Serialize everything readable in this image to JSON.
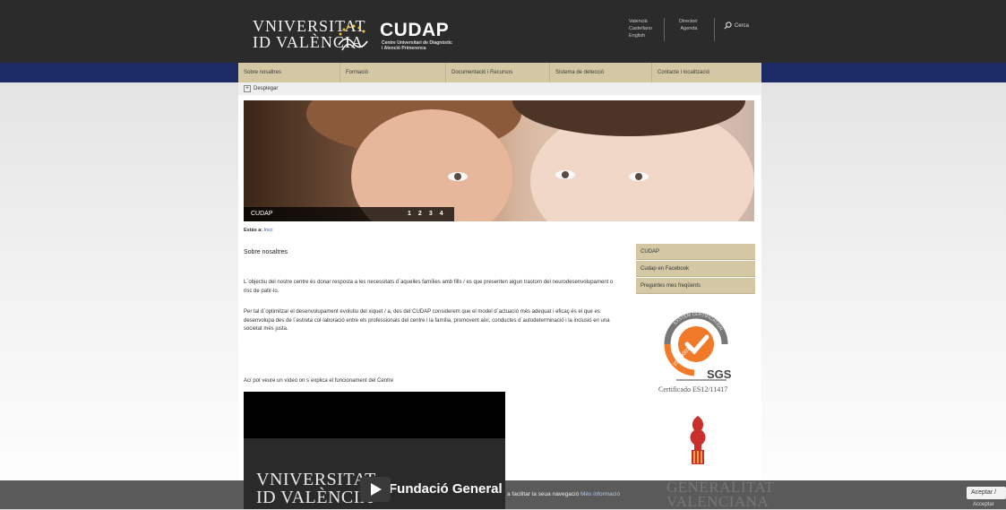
{
  "header": {
    "uv_line1": "VNIVERSITAT",
    "uv_line2": "ID VALÈNCIA",
    "cudap": "CUDAP",
    "cudap_sub1": "Centre Universitari de Diagnòstic",
    "cudap_sub2": "i Atenció Primerenca",
    "languages": [
      "Valencià",
      "Castellano",
      "English"
    ],
    "links": [
      "Directori",
      "Agenda"
    ],
    "search": "Cerca"
  },
  "menu": [
    "Sobre nosaltres",
    "Formació",
    "Documentació i Recursos",
    "Sistema de detecció",
    "Contacte i localització"
  ],
  "submenu": {
    "toggle": "Desplegar"
  },
  "hero": {
    "caption": "CUDAP",
    "slides": [
      "1",
      "2",
      "3",
      "4"
    ]
  },
  "breadcrumb": {
    "prefix": "Estàs a:",
    "link": "Inici"
  },
  "content": {
    "title": "Sobre nosaltres",
    "p1": "L´objectiu del nostre centre és donar resposta a les necessitats d´aquelles famílies amb fills / es que presenten algun trastorn del neurodesenvolupament o risc de patir-lo.",
    "p2": "Per tal d´optimitzar el desenvolupament evolutiu del xiquet / a, des del CUDAP considerem que el model d´actuació més adequat i eficaç és el que es desenvolupa des de l´estreta col·laboració entre els professionals del centre i la família, promovent així, conductes d´autodeterminació i la inclusió en una societat més justa.",
    "video_intro": "Ací pot veure un vídeo on s´explica el funcionament del Centre",
    "video_uv1": "VNIVERSITAT",
    "video_uv2": "ID VALÈNCIA",
    "video_fund": "Fundació General"
  },
  "sidebar": {
    "links": [
      "CUDAP",
      "Cudap en Facebook",
      "Preguntes mes freqüents"
    ],
    "sgs": "SGS",
    "iso": "ISO 9001",
    "system_cert": "SYSTEM CERTIFICATION",
    "certificado": "Certificado ES12/11417",
    "gva1": "GENERALITAT",
    "gva2": "VALENCIANA"
  },
  "cookie": {
    "text": "a facilitar la seua navegació",
    "more": "Més informació",
    "accept": "Aceptar /",
    "accept2": "Acceptar"
  },
  "colors": {
    "header": "#2b2b2b",
    "navstrip": "#1c2a66",
    "menu": "#d4c8a4",
    "accent": "#f07a2a"
  }
}
